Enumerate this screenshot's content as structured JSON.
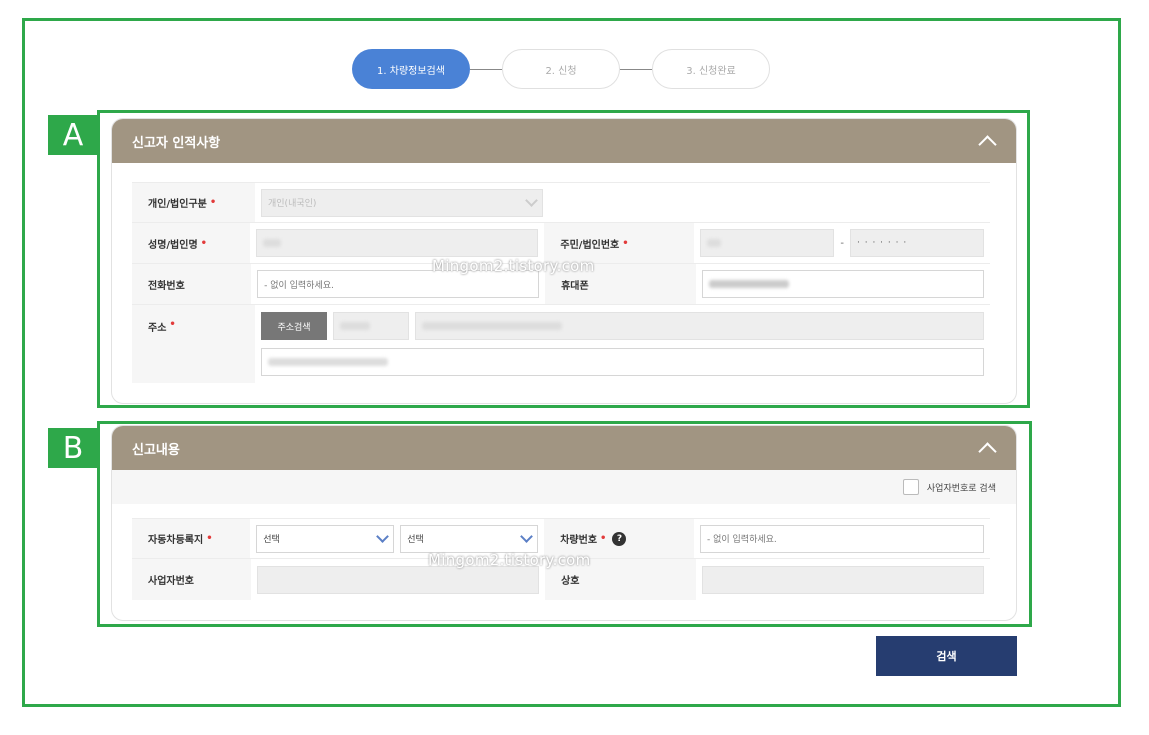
{
  "steps": [
    {
      "label": "1. 차량정보검색",
      "active": true
    },
    {
      "label": "2. 신청",
      "active": false
    },
    {
      "label": "3. 신청완료",
      "active": false
    }
  ],
  "markers": {
    "a": "A",
    "b": "B"
  },
  "watermark": "Mingom2.tistory.com",
  "reporter": {
    "title": "신고자 인적사항",
    "type_label": "개인/법인구분",
    "type_value": "개인(내국인)",
    "name_label": "성명/법인명",
    "reg_label": "주민/법인번호",
    "reg_dash": "-",
    "reg_masked": "· · · · · · ·",
    "phone_label": "전화번호",
    "phone_placeholder": "- 없이 입력하세요.",
    "mobile_label": "휴대폰",
    "address_label": "주소",
    "address_button": "주소검색"
  },
  "report": {
    "title": "신고내용",
    "biz_search_label": "사업자번호로 검색",
    "office_label": "자동차등록지",
    "select1": "선택",
    "select2": "선택",
    "plate_label": "차량번호",
    "help_glyph": "?",
    "plate_placeholder": "- 없이 입력하세요.",
    "biz_label": "사업자번호",
    "company_label": "상호"
  },
  "required_mark": "•",
  "search_button": "검색"
}
